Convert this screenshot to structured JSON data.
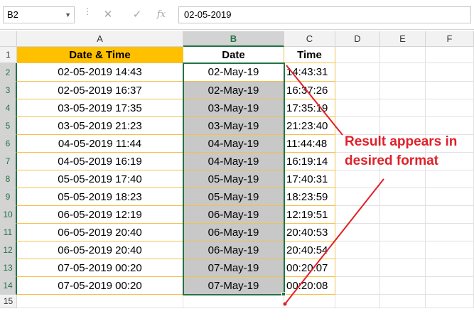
{
  "formula_bar": {
    "name_box": "B2",
    "cancel_symbol": "✕",
    "enter_symbol": "✓",
    "function_symbol": "fx",
    "formula_value": "02-05-2019"
  },
  "columns": [
    "A",
    "B",
    "C",
    "D",
    "E",
    "F"
  ],
  "rows": [
    "1",
    "2",
    "3",
    "4",
    "5",
    "6",
    "7",
    "8",
    "9",
    "10",
    "11",
    "12",
    "13",
    "14",
    "15"
  ],
  "headers": {
    "a": "Date & Time",
    "b": "Date",
    "c": "Time"
  },
  "data": [
    {
      "a": "02-05-2019 14:43",
      "b": "02-May-19",
      "c": "14:43:31"
    },
    {
      "a": "02-05-2019 16:37",
      "b": "02-May-19",
      "c": "16:37:26"
    },
    {
      "a": "03-05-2019 17:35",
      "b": "03-May-19",
      "c": "17:35:19"
    },
    {
      "a": "03-05-2019 21:23",
      "b": "03-May-19",
      "c": "21:23:40"
    },
    {
      "a": "04-05-2019 11:44",
      "b": "04-May-19",
      "c": "11:44:48"
    },
    {
      "a": "04-05-2019 16:19",
      "b": "04-May-19",
      "c": "16:19:14"
    },
    {
      "a": "05-05-2019 17:40",
      "b": "05-May-19",
      "c": "17:40:31"
    },
    {
      "a": "05-05-2019 18:23",
      "b": "05-May-19",
      "c": "18:23:59"
    },
    {
      "a": "06-05-2019 12:19",
      "b": "06-May-19",
      "c": "12:19:51"
    },
    {
      "a": "06-05-2019 20:40",
      "b": "06-May-19",
      "c": "20:40:53"
    },
    {
      "a": "06-05-2019 20:40",
      "b": "06-May-19",
      "c": "20:40:54"
    },
    {
      "a": "07-05-2019 00:20",
      "b": "07-May-19",
      "c": "00:20:07"
    },
    {
      "a": "07-05-2019 00:20",
      "b": "07-May-19",
      "c": "00:20:08"
    }
  ],
  "annotation": {
    "line1": "Result appears in",
    "line2": "desired format"
  },
  "colors": {
    "header_fill": "#ffc000",
    "selection": "#217346",
    "annotation": "#e0202a",
    "selected_fill": "#c8c8c8"
  }
}
